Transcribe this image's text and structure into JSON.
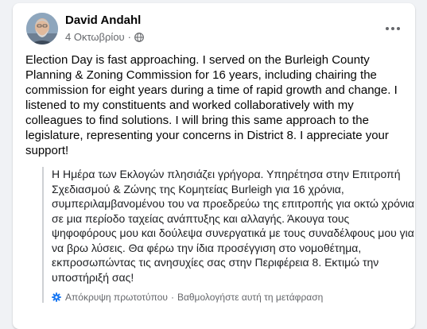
{
  "post": {
    "author": "David Andahl",
    "date": "4 Οκτωβρίου",
    "separator": "·",
    "privacy_icon": "globe-icon",
    "more_icon": "more-horizontal-icon",
    "text": "Election Day is fast approaching. I served on the Burleigh County Planning & Zoning Commission for 16 years, including chairing the commission for eight years during a time of rapid growth and change. I listened to my constituents and worked collaboratively with my colleagues to find solutions. I will bring this same approach to the legislature, representing your concerns in District 8. I appreciate your support!"
  },
  "translation": {
    "text": "Η Ημέρα των Εκλογών πλησιάζει γρήγορα. Υπηρέτησα στην Επιτροπή Σχεδιασμού & Ζώνης της Κομητείας Burleigh για 16 χρόνια, συμπεριλαμβανομένου του να προεδρεύω της επιτροπής για οκτώ χρόνια σε μια περίοδο ταχείας ανάπτυξης και αλλαγής. Άκουγα τους ψηφοφόρους μου και δούλεψα συνεργατικά με τους συναδέλφους μου για να βρω λύσεις. Θα φέρω την ίδια προσέγγιση στο νομοθέτημα, εκπροσωπώντας τις ανησυχίες σας στην Περιφέρεια 8. Εκτιμώ την υποστήριξή σας!",
    "hide_original": "Απόκρυψη πρωτοτύπου",
    "separator": "·",
    "rate": "Βαθμολογήστε αυτή τη μετάφραση",
    "icon": "gear-icon"
  },
  "colors": {
    "background": "#f0f2f5",
    "card": "#ffffff",
    "secondary_text": "#65676b",
    "quote_bar": "#ced0d4",
    "icon_blue": "#1877f2"
  }
}
